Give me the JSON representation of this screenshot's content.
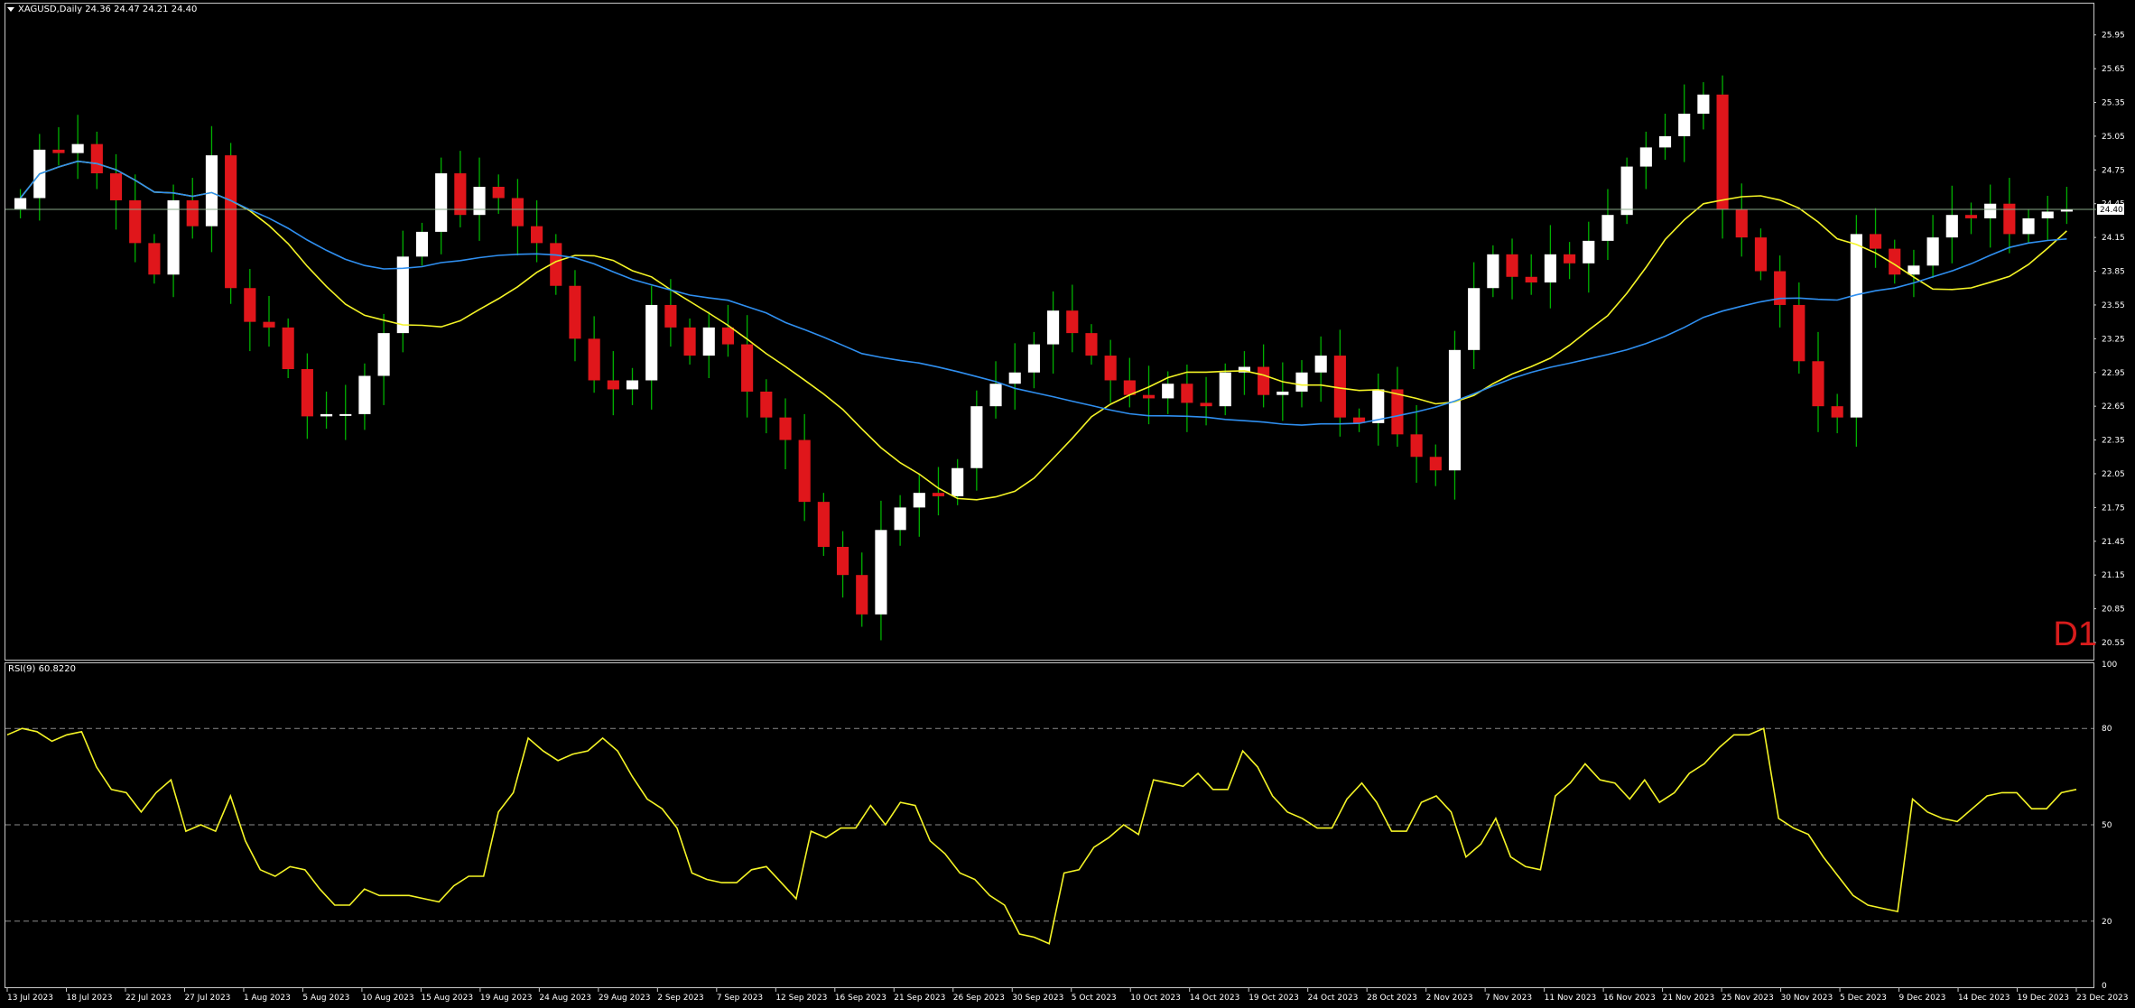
{
  "window": {
    "symbol_header": "XAGUSD,Daily  24.36 24.47 24.21 24.40",
    "timeframe_label": "D1",
    "current_price_label": "24.40",
    "rsi_header": "RSI(9) 60.8220"
  },
  "colors": {
    "background": "#000000",
    "frame": "#c8c8c8",
    "bull_candle": "#ffffff",
    "bear_candle": "#e0161b",
    "wick": "#00b000",
    "ma_fast": "#f4f426",
    "ma_slow": "#2f8ff0",
    "rsi_line": "#f4f426",
    "level_line": "#8a8a8a",
    "price_line": "#88a888"
  },
  "chart_data": {
    "type": "candlestick",
    "symbol": "XAGUSD",
    "timeframe": "Daily",
    "price_axis": {
      "ylim": [
        20.55,
        26.1
      ],
      "ticks": [
        "25.95",
        "25.65",
        "25.35",
        "25.05",
        "24.75",
        "24.45",
        "24.15",
        "23.85",
        "23.55",
        "23.25",
        "22.95",
        "22.65",
        "22.35",
        "22.05",
        "21.75",
        "21.45",
        "21.15",
        "20.85",
        "20.55"
      ]
    },
    "date_labels": [
      "13 Jul 2023",
      "18 Jul 2023",
      "22 Jul 2023",
      "27 Jul 2023",
      "1 Aug 2023",
      "5 Aug 2023",
      "10 Aug 2023",
      "15 Aug 2023",
      "19 Aug 2023",
      "24 Aug 2023",
      "29 Aug 2023",
      "2 Sep 2023",
      "7 Sep 2023",
      "12 Sep 2023",
      "16 Sep 2023",
      "21 Sep 2023",
      "26 Sep 2023",
      "30 Sep 2023",
      "5 Oct 2023",
      "10 Oct 2023",
      "14 Oct 2023",
      "19 Oct 2023",
      "24 Oct 2023",
      "28 Oct 2023",
      "2 Nov 2023",
      "7 Nov 2023",
      "11 Nov 2023",
      "16 Nov 2023",
      "21 Nov 2023",
      "25 Nov 2023",
      "30 Nov 2023",
      "5 Dec 2023",
      "9 Dec 2023",
      "14 Dec 2023",
      "19 Dec 2023",
      "23 Dec 2023"
    ],
    "closes": [
      24.5,
      24.93,
      24.9,
      24.98,
      24.72,
      24.48,
      24.1,
      23.82,
      24.48,
      24.25,
      24.88,
      23.7,
      23.4,
      23.35,
      22.98,
      22.56,
      22.58,
      22.58,
      22.92,
      23.3,
      23.98,
      24.2,
      24.72,
      24.35,
      24.6,
      24.5,
      24.25,
      24.1,
      23.72,
      23.25,
      22.88,
      22.8,
      22.88,
      23.55,
      23.35,
      23.1,
      23.35,
      23.2,
      22.78,
      22.55,
      22.35,
      21.8,
      21.4,
      21.15,
      20.8,
      21.55,
      21.75,
      21.88,
      21.85,
      22.1,
      22.65,
      22.85,
      22.95,
      23.2,
      23.5,
      23.3,
      23.1,
      22.88,
      22.75,
      22.72,
      22.85,
      22.68,
      22.65,
      22.95,
      23.0,
      22.75,
      22.78,
      22.95,
      23.1,
      22.55,
      22.5,
      22.8,
      22.4,
      22.2,
      22.08,
      23.15,
      23.7,
      24.0,
      23.8,
      23.75,
      24.0,
      23.92,
      24.12,
      24.35,
      24.78,
      24.95,
      25.05,
      25.25,
      25.42,
      24.4,
      24.15,
      23.85,
      23.55,
      23.05,
      22.65,
      22.55,
      24.18,
      24.05,
      23.82,
      23.9,
      24.15,
      24.35,
      24.32,
      24.45,
      24.18,
      24.32,
      24.38,
      24.4
    ],
    "moving_averages": [
      {
        "name": "MA fast",
        "period_hint": "short",
        "color": "#f4f426"
      },
      {
        "name": "MA slow",
        "period_hint": "long",
        "color": "#2f8ff0"
      }
    ],
    "rsi": {
      "period": 9,
      "last_value": 60.822,
      "ylim": [
        0,
        100
      ],
      "ticks": [
        "100",
        "80",
        "50",
        "20",
        "0"
      ],
      "levels": [
        80,
        50,
        20
      ],
      "values": [
        78,
        80,
        79,
        76,
        78,
        79,
        68,
        61,
        60,
        54,
        60,
        64,
        48,
        50,
        48,
        59,
        45,
        36,
        34,
        37,
        36,
        30,
        25,
        25,
        30,
        28,
        28,
        28,
        27,
        26,
        31,
        34,
        34,
        54,
        60,
        77,
        73,
        70,
        72,
        73,
        77,
        73,
        65,
        58,
        55,
        49,
        35,
        33,
        32,
        32,
        36,
        37,
        32,
        27,
        48,
        46,
        49,
        49,
        56,
        50,
        57,
        56,
        45,
        41,
        35,
        33,
        28,
        25,
        16,
        15,
        13,
        35,
        36,
        43,
        46,
        50,
        47,
        64,
        63,
        62,
        66,
        61,
        61,
        73,
        68,
        59,
        54,
        52,
        49,
        49,
        58,
        63,
        57,
        48,
        48,
        57,
        59,
        54,
        40,
        44,
        52,
        40,
        37,
        36,
        59,
        63,
        69,
        64,
        63,
        58,
        64,
        57,
        60,
        66,
        69,
        74,
        78,
        78,
        80,
        52,
        49,
        47,
        40,
        34,
        28,
        25,
        24,
        23,
        58,
        54,
        52,
        51,
        55,
        59,
        60,
        60,
        55,
        55,
        60,
        61
      ]
    }
  }
}
